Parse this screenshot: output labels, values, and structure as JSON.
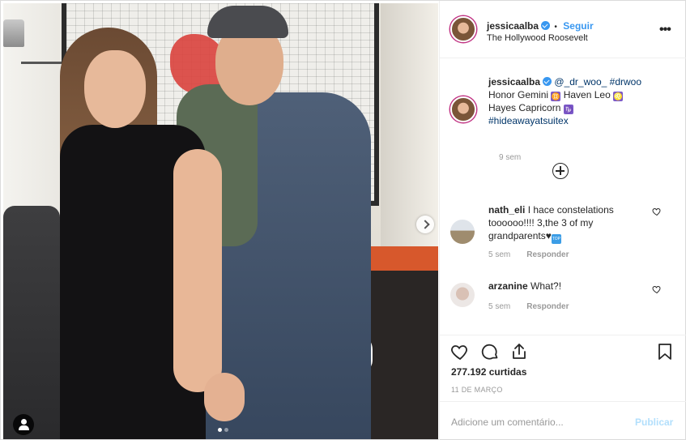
{
  "post": {
    "photo_alt": "",
    "carousel": {
      "current": 1,
      "total": 2
    }
  },
  "header": {
    "username": "jessicaalba",
    "follow_label": "Seguir",
    "separator": "•",
    "location": "The Hollywood Roosevelt",
    "more_label": "•••"
  },
  "caption": {
    "username": "jessicaalba",
    "mention": "@_dr_woo_",
    "hashtag1": "#drwoo",
    "line2_a": "Honor Gemini",
    "zodiac_gemini": "♊",
    "line2_b": "Haven Leo",
    "zodiac_leo": "♌",
    "line3_a": "Hayes Capricorn",
    "zodiac_capricorn": "♑",
    "hashtag2": "#hideawayatsuitex",
    "time": "9 sem"
  },
  "comments": [
    {
      "username": "nath_eli",
      "text": "I hace constelations toooooo!!!! 3,the 3 of my grandparents",
      "emoji_heart": "♥",
      "emoji_top": "TOP",
      "time": "5 sem",
      "reply_label": "Responder"
    },
    {
      "username": "arzanine",
      "text": "What?!",
      "time": "5 sem",
      "reply_label": "Responder"
    }
  ],
  "actions": {
    "likes": "277.192 curtidas",
    "date": "11 DE MARÇO"
  },
  "add_comment": {
    "placeholder": "Adicione um comentário...",
    "publish_label": "Publicar"
  },
  "colors": {
    "link_blue": "#3897f0",
    "text": "#262626",
    "muted": "#999999",
    "publish_disabled": "#b2dffc",
    "border": "#efefef"
  },
  "icons": [
    "user-tag-icon",
    "next-arrow-icon",
    "verified-badge-icon",
    "more-options-icon",
    "load-more-comments-icon",
    "heart-icon",
    "comment-icon",
    "share-icon",
    "bookmark-icon"
  ]
}
